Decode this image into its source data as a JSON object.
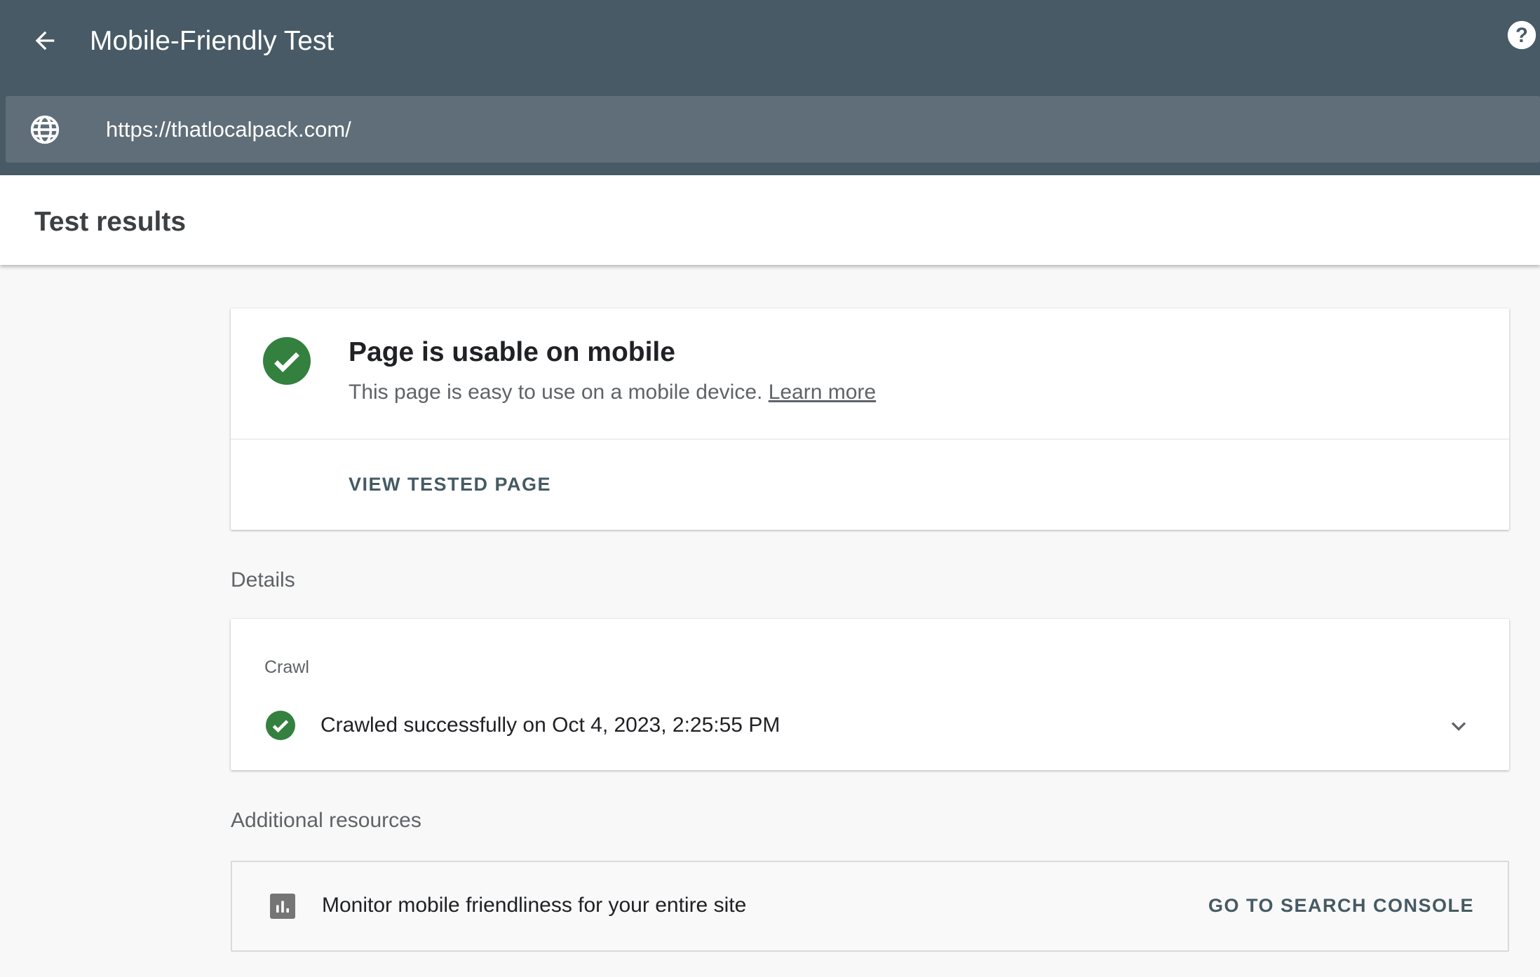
{
  "header": {
    "title": "Mobile-Friendly Test",
    "url": "https://thatlocalpack.com/"
  },
  "subheader": {
    "title": "Test results"
  },
  "result": {
    "title": "Page is usable on mobile",
    "description": "This page is easy to use on a mobile device.",
    "learn_more": "Learn more",
    "view_button": "VIEW TESTED PAGE"
  },
  "details": {
    "label": "Details",
    "crawl_label": "Crawl",
    "crawl_status": "Crawled successfully on Oct 4, 2023, 2:25:55 PM"
  },
  "resources": {
    "label": "Additional resources",
    "monitor_text": "Monitor mobile friendliness for your entire site",
    "button": "GO TO SEARCH CONSOLE"
  },
  "colors": {
    "header": "#485a65",
    "urlbar": "#5f6e78",
    "success": "#34803f"
  }
}
